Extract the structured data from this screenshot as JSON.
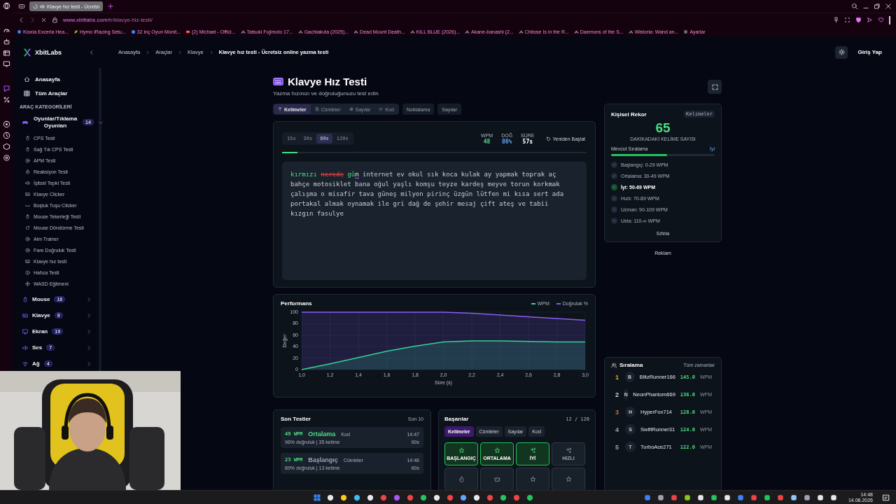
{
  "browser": {
    "tab_title": "Klavye hız testi - Ücretsi",
    "url_host": "www.xbitlabs.com",
    "url_path": "/tr/klavye-hiz-testi/",
    "bookmarks": [
      {
        "label": "Kioxia Exceria Hea...",
        "kind": "site"
      },
      {
        "label": "Hymo iRacing Setu...",
        "kind": "leaf"
      },
      {
        "label": "32 inç Oyun Monit...",
        "kind": "badge"
      },
      {
        "label": "(2) Michael - Offici...",
        "kind": "video"
      },
      {
        "label": "Tatsuki Fujimoto 17...",
        "kind": "peak"
      },
      {
        "label": "Gachiakuta (2025)...",
        "kind": "peak"
      },
      {
        "label": "Dead Mount Death...",
        "kind": "peak"
      },
      {
        "label": "KILL BLUE (2026)...",
        "kind": "peak"
      },
      {
        "label": "Akane-banashi (2...",
        "kind": "peak"
      },
      {
        "label": "Chitose Is in the R...",
        "kind": "peak"
      },
      {
        "label": "Daemons of the S...",
        "kind": "peak"
      },
      {
        "label": "Wistoria: Wand an...",
        "kind": "peak"
      },
      {
        "label": "Ayarlar",
        "kind": "box"
      }
    ]
  },
  "header": {
    "logo": "XbitLabs",
    "breadcrumb": [
      "Anasayfa",
      "Araçlar",
      "Klavye",
      "Klavye hız testi - Ücretsiz online yazma testi"
    ],
    "login": "Giriş Yap"
  },
  "sidebar": {
    "items": [
      {
        "label": "Anasayfa",
        "kind": "home"
      },
      {
        "label": "Tüm Araçlar",
        "kind": "grid"
      }
    ],
    "section_title": "ARAÇ KATEGORİLERİ",
    "categories": [
      {
        "label": "Oyunlar/Tıklama Oyunları",
        "count": "14",
        "kind": "gamepad",
        "expanded": true,
        "children": [
          {
            "label": "CPS Testi",
            "kind": "mouse"
          },
          {
            "label": "Sağ Tık CPS Testi",
            "kind": "mouse"
          },
          {
            "label": "APM Testi",
            "kind": "target"
          },
          {
            "label": "Reaksiyon Testi",
            "kind": "timer"
          },
          {
            "label": "İşitsel Tepki Testi",
            "kind": "speaker"
          },
          {
            "label": "Klavye Clicker",
            "kind": "keyboard"
          },
          {
            "label": "Boşluk Tuşu Clicker",
            "kind": "space"
          },
          {
            "label": "Mouse Tekerleği Testi",
            "kind": "mouse"
          },
          {
            "label": "Mouse Döndürme Testi",
            "kind": "rotate"
          },
          {
            "label": "Aim Trainer",
            "kind": "target"
          },
          {
            "label": "Fare Doğruluk Testi",
            "kind": "target"
          },
          {
            "label": "Klavye hız testi",
            "kind": "keyboard"
          },
          {
            "label": "Hafıza Testi",
            "kind": "info"
          },
          {
            "label": "WASD Eğitmeni",
            "kind": "move"
          }
        ]
      },
      {
        "label": "Mouse",
        "count": "16",
        "kind": "mouse",
        "expanded": false
      },
      {
        "label": "Klavye",
        "count": "9",
        "kind": "keyboard",
        "expanded": false
      },
      {
        "label": "Ekran",
        "count": "19",
        "kind": "monitor",
        "expanded": false
      },
      {
        "label": "Ses",
        "count": "7",
        "kind": "speaker",
        "expanded": false
      },
      {
        "label": "Ağ",
        "count": "4",
        "kind": "wifi",
        "expanded": false
      }
    ]
  },
  "page": {
    "title": "Klavye Hız Testi",
    "subtitle": "Yazma hızınızı ve doğruluğunuzu test edin"
  },
  "modes": [
    {
      "label": "Kelimeler",
      "kind": "type",
      "selected": true
    },
    {
      "label": "Cümleler",
      "kind": "note",
      "selected": false
    },
    {
      "label": "Sayılar",
      "kind": "hash",
      "selected": false
    },
    {
      "label": "Kod",
      "kind": "code",
      "selected": false
    }
  ],
  "toggles": [
    {
      "label": "Noktalama",
      "on": false
    },
    {
      "label": "Sayılar",
      "on": false
    }
  ],
  "test": {
    "durations": [
      {
        "label": "15s",
        "selected": false
      },
      {
        "label": "30s",
        "selected": false
      },
      {
        "label": "60s",
        "selected": true
      },
      {
        "label": "120s",
        "selected": false
      }
    ],
    "stats": [
      {
        "label": "WPM",
        "value": "48",
        "kind": "wpm"
      },
      {
        "label": "DOĞ",
        "value": "86%",
        "kind": "accuracy"
      },
      {
        "label": "SÜRE",
        "value": "57s",
        "kind": "time"
      }
    ],
    "restart": "Yeniden Başlat",
    "progress": {
      "level": 0.05
    },
    "words": [
      {
        "text": "kırmızı",
        "correct": true
      },
      {
        "text": "nerede",
        "correct": false
      }
    ],
    "current": {
      "typed": "gü",
      "rest": "n"
    },
    "upcoming_lines": [
      "internet ev okul sık koca kulak ay yapmak toprak aç",
      "bahçe motosiklet bana oğul yaşlı komşu teyze kardeş meyve torun korkmak",
      "çalışma o misafir tava güneş milyon pirinç üzgün lütfen mi kısa sert ada",
      "portakal almak oynamak ile gri dağ de şehir mesaj çift ateş ve tabii",
      "kızgın fasulye"
    ]
  },
  "performance": {
    "title": "Performans",
    "chart_data": {
      "type": "area",
      "xlabel": "Süre (s)",
      "ylabel": "Değer",
      "x": [
        1.0,
        1.2,
        1.4,
        1.6,
        1.8,
        2.0,
        2.2,
        2.4,
        2.6,
        2.8,
        3.0
      ],
      "series": [
        {
          "name": "WPM",
          "color": "#34d399",
          "values": [
            0,
            10,
            21,
            32,
            41,
            48,
            50,
            50,
            49,
            48,
            48
          ]
        },
        {
          "name": "Doğruluk %",
          "color": "#8b5cf6",
          "values": [
            100,
            100,
            100,
            100,
            100,
            100,
            98,
            95,
            92,
            89,
            86
          ]
        }
      ],
      "xlim": [
        1.0,
        3.0
      ],
      "ylim": [
        0,
        100
      ],
      "grid": true,
      "yticks": [
        0,
        20,
        40,
        60,
        80,
        100
      ],
      "xticks": [
        {
          "value": 1.0,
          "label": "1,0"
        },
        {
          "value": 1.2,
          "label": "1,2"
        },
        {
          "value": 1.4,
          "label": "1,4"
        },
        {
          "value": 1.6,
          "label": "1,6"
        },
        {
          "value": 1.8,
          "label": "1,8"
        },
        {
          "value": 2.0,
          "label": "2,0"
        },
        {
          "value": 2.2,
          "label": "2,2"
        },
        {
          "value": 2.4,
          "label": "2,4"
        },
        {
          "value": 2.6,
          "label": "2,6"
        },
        {
          "value": 2.8,
          "label": "2,8"
        },
        {
          "value": 3.0,
          "label": "3,0"
        }
      ]
    }
  },
  "recent": {
    "title": "Son Testler",
    "note": "Son 10",
    "items": [
      {
        "wpm": "49 WPM",
        "level": "Ortalama",
        "color": "#4ade80",
        "mode": "Kod",
        "time": "14:47",
        "detail": "96% doğruluk | 35 kelime",
        "duration": "60s"
      },
      {
        "wpm": "23 WPM",
        "level": "Başlangıç",
        "color": "#9ca3af",
        "mode": "Cümleler",
        "time": "14:46",
        "detail": "89% doğruluk | 13 kelime",
        "duration": "60s"
      }
    ]
  },
  "achievements": {
    "title": "Başarılar",
    "count": "12 / 120",
    "tabs": [
      {
        "label": "Kelimeler",
        "selected": true
      },
      {
        "label": "Cümleler",
        "selected": false
      },
      {
        "label": "Sayılar",
        "selected": false
      },
      {
        "label": "Kod",
        "selected": false
      }
    ],
    "badges": [
      {
        "label": "BAŞLANGIÇ",
        "kind": "star",
        "unlocked": true
      },
      {
        "label": "ORTALAMA",
        "kind": "star",
        "unlocked": true
      },
      {
        "label": "İYİ",
        "kind": "sparkle",
        "unlocked": true
      },
      {
        "label": "HIZLI",
        "kind": "sparkle",
        "unlocked": false
      },
      {
        "kind": "flame",
        "unlocked": false
      },
      {
        "kind": "crown",
        "unlocked": false
      },
      {
        "kind": "star",
        "unlocked": false
      },
      {
        "kind": "star",
        "unlocked": false
      }
    ]
  },
  "record": {
    "title": "Kişisel Rekor",
    "mode": "Kelimeler",
    "value": "65",
    "caption": "DAKİKADAKİ KELİME SAYISI",
    "rank_label": "Mevcut Sıralama",
    "rank": "İyi",
    "level": 0.54,
    "tiers": [
      {
        "label": "Başlangıç: 0-29 WPM",
        "achieved": true,
        "current": false
      },
      {
        "label": "Ortalama: 30-49 WPM",
        "achieved": true,
        "current": false
      },
      {
        "label": "İyi: 50-69 WPM",
        "achieved": true,
        "current": true
      },
      {
        "label": "Hızlı: 70-89 WPM",
        "achieved": false,
        "current": false
      },
      {
        "label": "Uzman: 90-109 WPM",
        "achieved": false,
        "current": false
      },
      {
        "label": "Usta: 110-∞ WPM",
        "achieved": false,
        "current": false
      }
    ],
    "reset": "Sıfırla"
  },
  "ad_label": "Reklam",
  "leaderboard": {
    "title": "Sıralama",
    "period": "Tüm zamanlar",
    "rows": [
      {
        "rank": "1",
        "color": "#eab308",
        "initial": "B",
        "name": "BlitzRunner166",
        "score": "145.0",
        "unit": "WPM"
      },
      {
        "rank": "2",
        "color": "#d1d5db",
        "initial": "N",
        "name": "NeonPhantom669",
        "score": "136.0",
        "unit": "WPM"
      },
      {
        "rank": "3",
        "color": "#c2703d",
        "initial": "H",
        "name": "HyperFox714",
        "score": "128.0",
        "unit": "WPM"
      },
      {
        "rank": "4",
        "color": "#9ca3af",
        "initial": "S",
        "name": "SwiftRunner31",
        "score": "124.0",
        "unit": "WPM"
      },
      {
        "rank": "5",
        "color": "#9ca3af",
        "initial": "T",
        "name": "TurboAce271",
        "score": "122.0",
        "unit": "WPM"
      }
    ]
  },
  "taskbar": {
    "time": "14:48",
    "date": "14.08.2026"
  }
}
